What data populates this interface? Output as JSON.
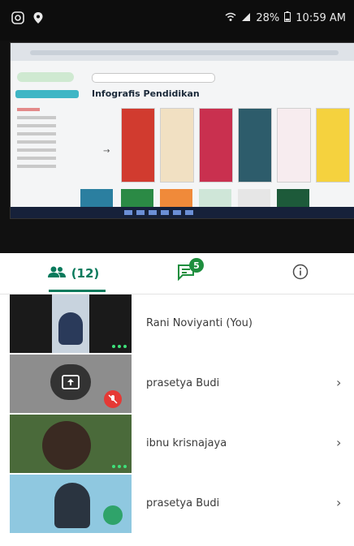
{
  "status_bar": {
    "battery": "28%",
    "time": "10:59 AM"
  },
  "shared_screen": {
    "gallery_title": "Infografis Pendidikan",
    "tile_colors": [
      "#d13b2f",
      "#f1e0c2",
      "#c9304f",
      "#2d5c6b",
      "#f0c74a",
      "#f7ecef",
      "#f5d23e"
    ]
  },
  "tabs": {
    "people_count": "(12)",
    "chat_badge": "5"
  },
  "participants": [
    {
      "name": "Rani Noviyanti (You)",
      "thumb_bg": "#1a1a1a",
      "status": "more"
    },
    {
      "name": "prasetya Budi",
      "thumb_bg": "#8d8d8d",
      "status": "muted"
    },
    {
      "name": "ibnu krisnajaya",
      "thumb_bg": "#4a6a3a",
      "status": "more"
    },
    {
      "name": "prasetya Budi",
      "thumb_bg": "#8fc8e0",
      "status": "speaking"
    }
  ],
  "colors": {
    "accent": "#0a7a5c",
    "badge": "#1e8e3e",
    "muted_red": "#e53935",
    "more_dots": "#3ee07a"
  }
}
